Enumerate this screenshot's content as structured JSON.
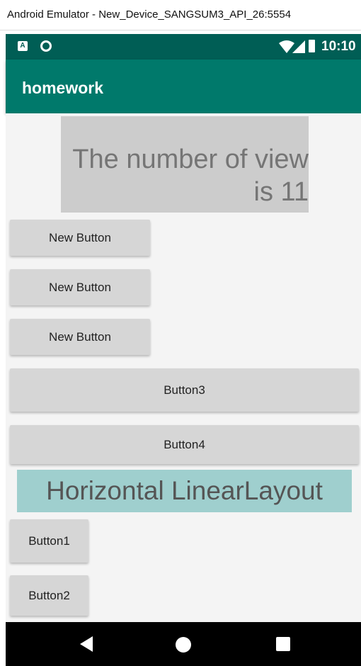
{
  "window": {
    "title": "Android Emulator - New_Device_SANGSUM3_API_26:5554"
  },
  "status_bar": {
    "time": "10:10",
    "notif_icon_letter": "A"
  },
  "app_bar": {
    "title": "homework"
  },
  "content": {
    "count_text": "The number of view is 11",
    "vertical_buttons": [
      "New Button",
      "New Button",
      "New Button"
    ],
    "wide_buttons": [
      "Button3",
      "Button4"
    ],
    "horizontal_label": "Horizontal LinearLayout",
    "small_buttons": [
      "Button1",
      "Button2"
    ]
  },
  "colors": {
    "status_bar": "#005e55",
    "app_bar": "#00796b",
    "count_box": "#cccccc",
    "horizontal_label_bg": "#9fcfce",
    "button_bg": "#d6d6d6",
    "nav_bar": "#000000"
  },
  "icons": {
    "status_left": [
      "a-notification-icon",
      "circle-notification-icon"
    ],
    "status_right": [
      "wifi-icon",
      "signal-icon",
      "battery-icon"
    ],
    "nav": [
      "back-icon",
      "home-icon",
      "recents-icon"
    ]
  }
}
